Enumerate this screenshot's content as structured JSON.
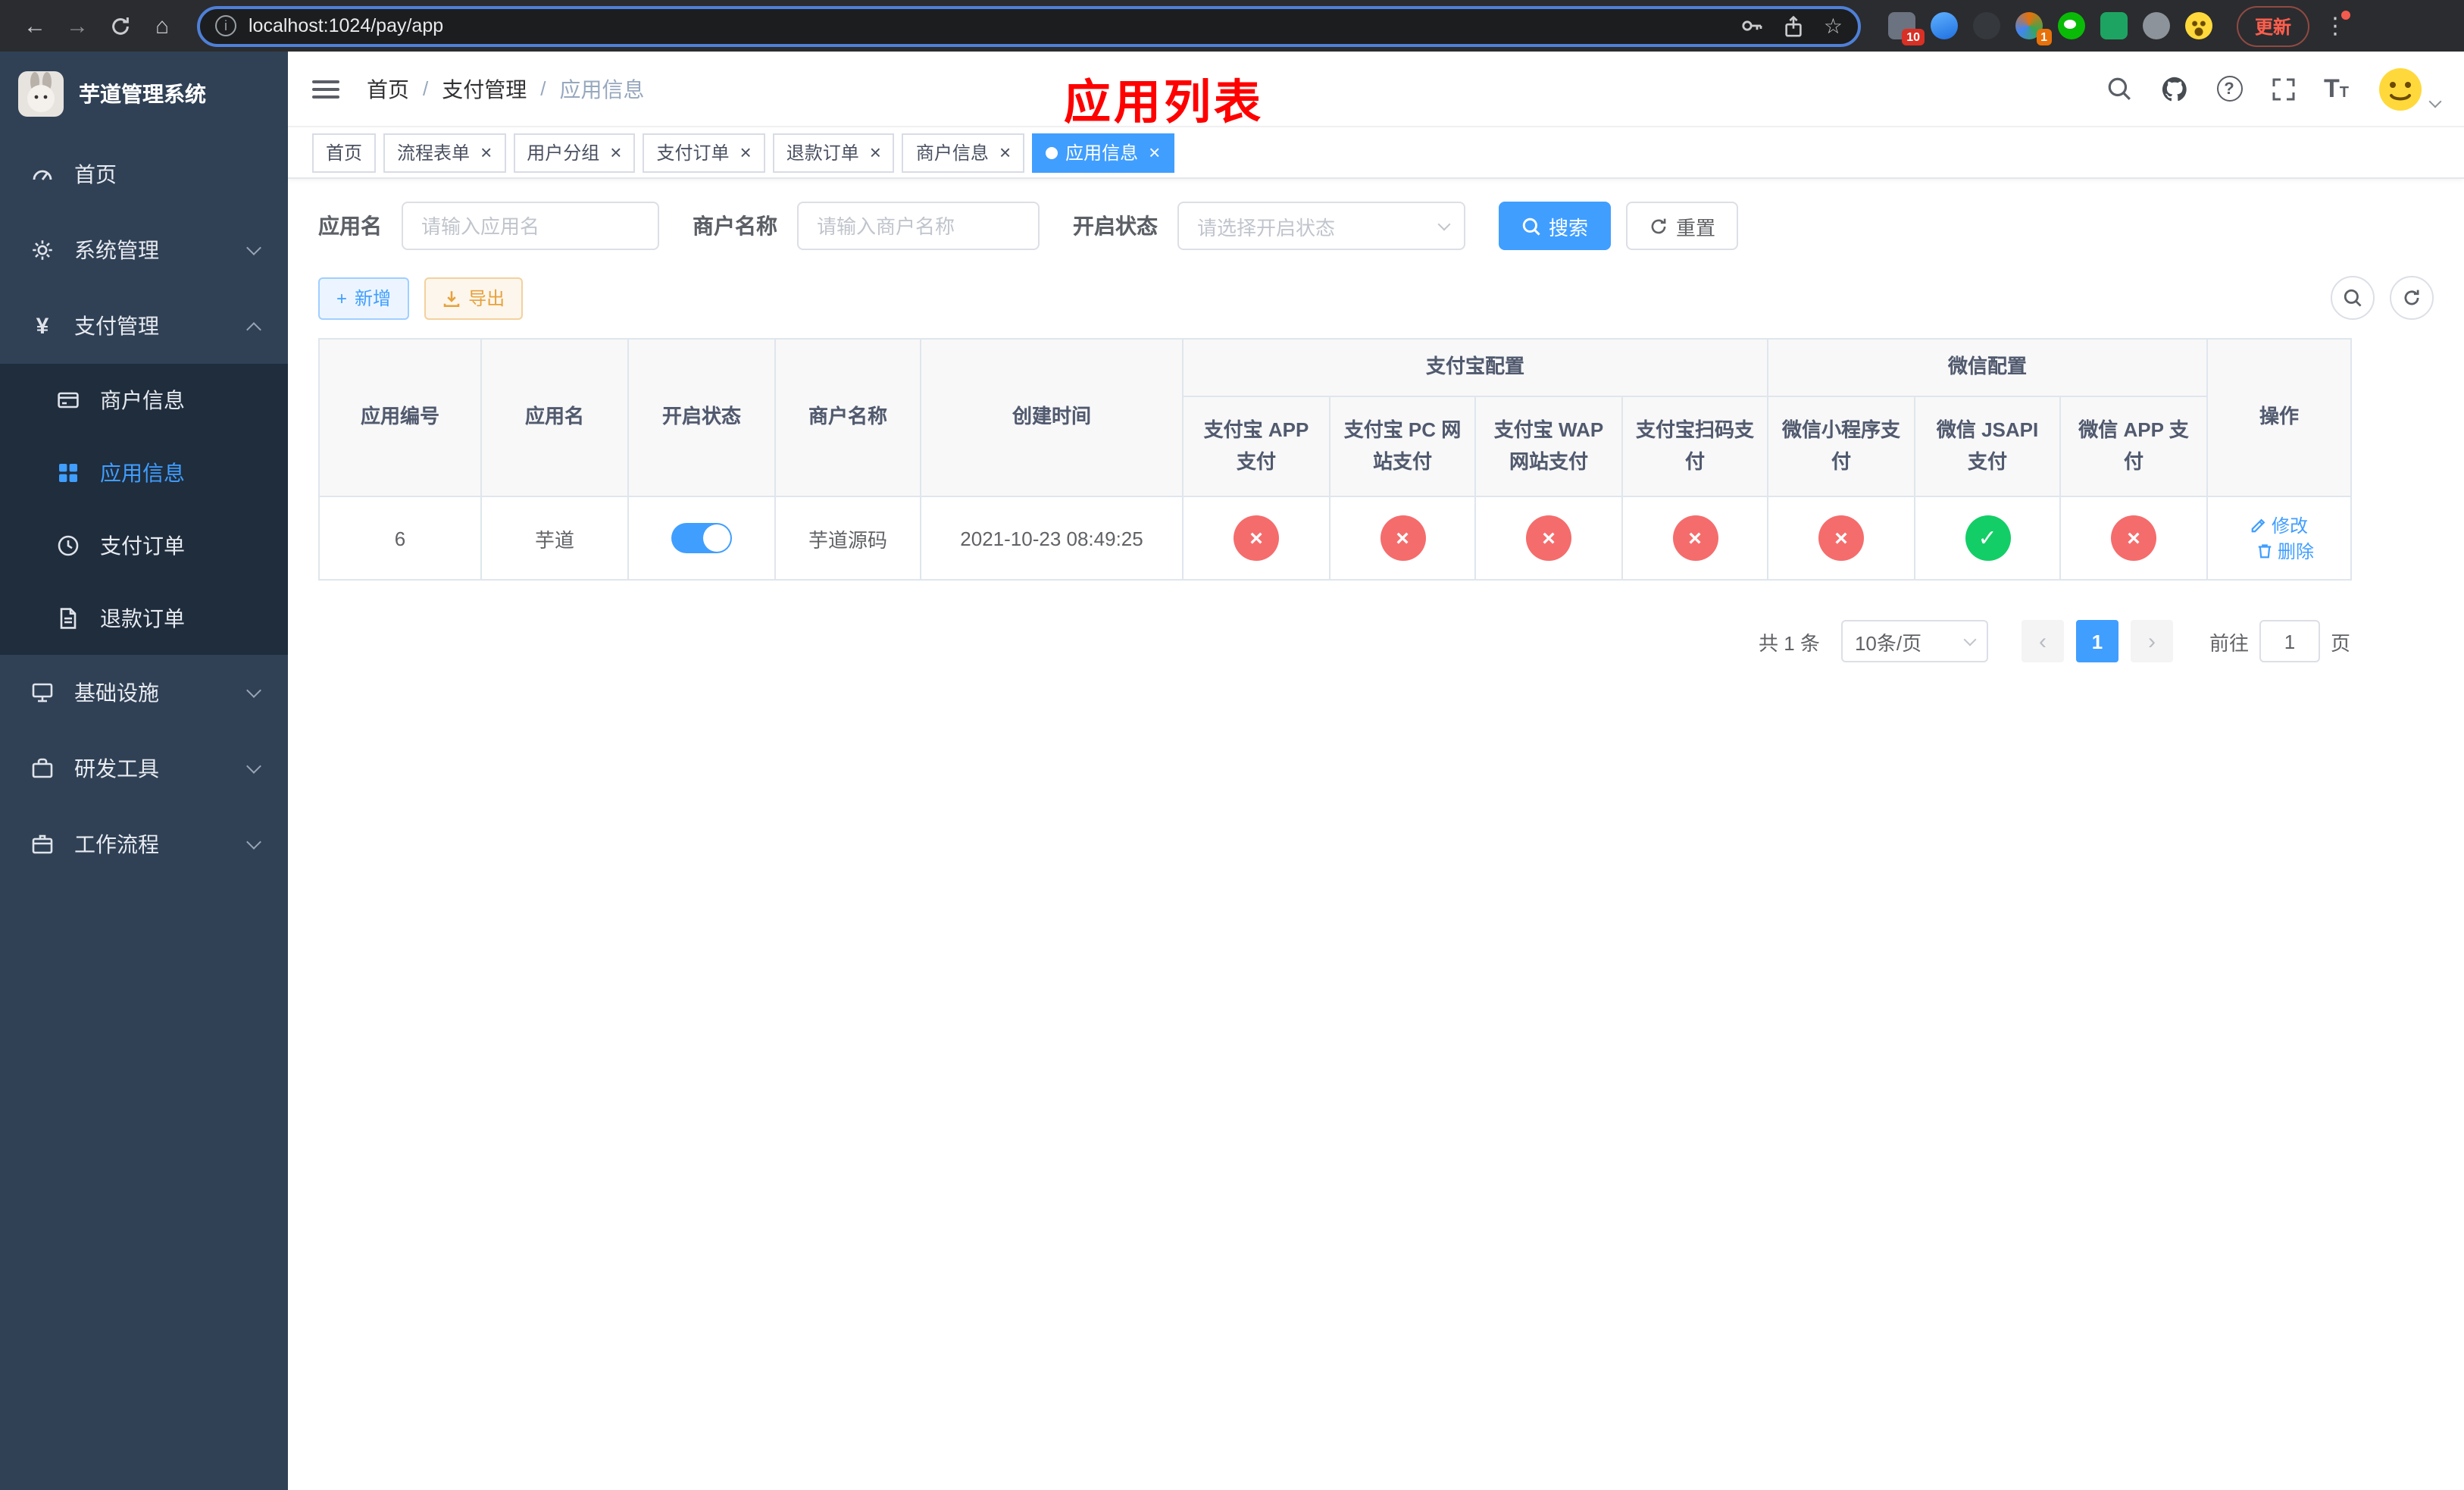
{
  "colors": {
    "primary": "#409eff",
    "success": "#13ce66",
    "danger": "#f56c6c",
    "warning": "#e6a23c",
    "annotation_red": "#fe0000",
    "sidebar_bg": "#304156",
    "submenu_bg": "#1f2d3d"
  },
  "browser": {
    "url": "localhost:1024/pay/app",
    "update_label": "更新",
    "ext_badge_primary": "10",
    "ext_badge_secondary": "1"
  },
  "sidebar": {
    "title": "芋道管理系统",
    "items": [
      {
        "label": "首页"
      },
      {
        "label": "系统管理"
      },
      {
        "label": "支付管理"
      },
      {
        "label": "基础设施"
      },
      {
        "label": "研发工具"
      },
      {
        "label": "工作流程"
      }
    ],
    "payment_children": [
      {
        "label": "商户信息"
      },
      {
        "label": "应用信息"
      },
      {
        "label": "支付订单"
      },
      {
        "label": "退款订单"
      }
    ]
  },
  "header": {
    "breadcrumb": [
      "首页",
      "支付管理",
      "应用信息"
    ],
    "annotation": "应用列表"
  },
  "tabs": {
    "items": [
      "首页",
      "流程表单",
      "用户分组",
      "支付订单",
      "退款订单",
      "商户信息",
      "应用信息"
    ]
  },
  "search": {
    "app_name_label": "应用名",
    "app_name_placeholder": "请输入应用名",
    "merchant_label": "商户名称",
    "merchant_placeholder": "请输入商户名称",
    "status_label": "开启状态",
    "status_placeholder": "请选择开启状态",
    "search_label": "搜索",
    "reset_label": "重置"
  },
  "toolbar": {
    "add_label": "新增",
    "export_label": "导出"
  },
  "table": {
    "columns": {
      "id": "应用编号",
      "name": "应用名",
      "status": "开启状态",
      "merchant": "商户名称",
      "created": "创建时间",
      "actions": "操作"
    },
    "groups": {
      "alipay": "支付宝配置",
      "wechat": "微信配置"
    },
    "sub_columns": [
      "支付宝 APP 支付",
      "支付宝 PC 网站支付",
      "支付宝 WAP 网站支付",
      "支付宝扫码支付",
      "微信小程序支付",
      "微信 JSAPI 支付",
      "微信 APP 支付"
    ],
    "row": {
      "id": "6",
      "name": "芋道",
      "enabled": true,
      "merchant": "芋道源码",
      "created": "2021-10-23 08:49:25",
      "configs": [
        "no",
        "no",
        "no",
        "no",
        "no",
        "yes",
        "no"
      ],
      "edit_label": "修改",
      "delete_label": "删除"
    }
  },
  "pagination": {
    "total": "共 1 条",
    "page_size": "10条/页",
    "page": "1",
    "goto_label": "前往",
    "goto_value": "1",
    "unit_label": "页"
  }
}
